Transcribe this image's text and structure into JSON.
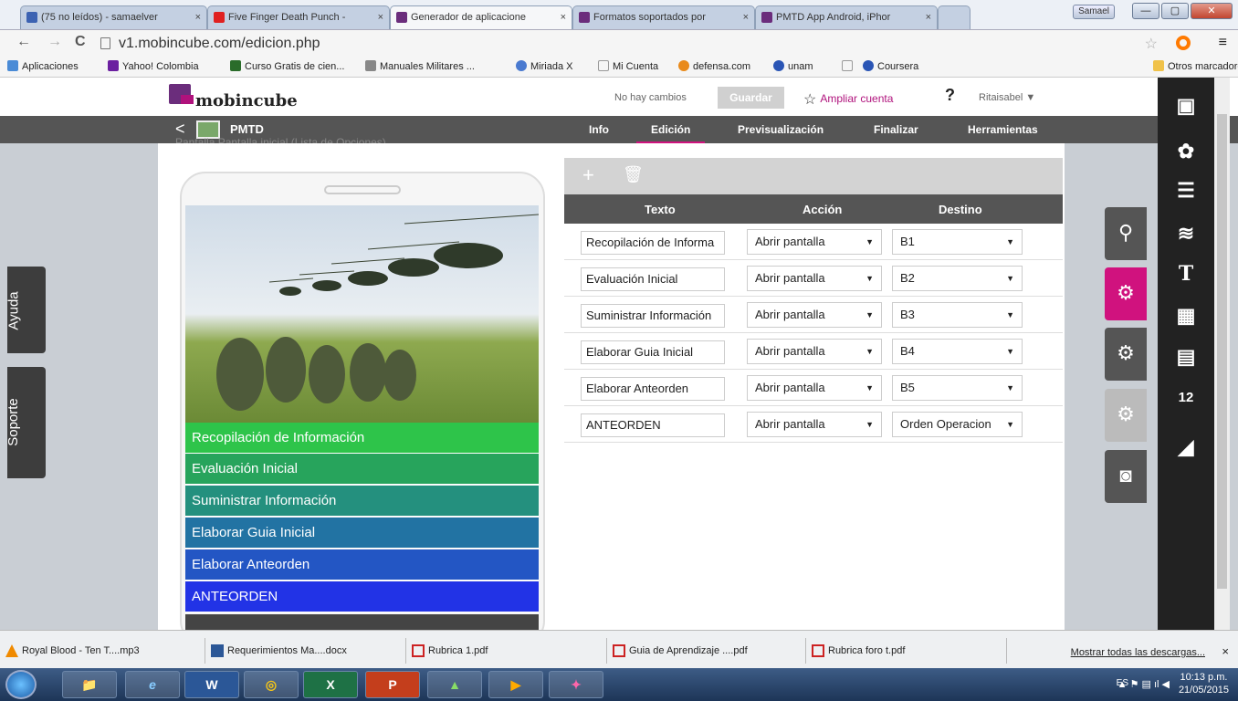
{
  "browser": {
    "tabs": [
      {
        "title": "(75 no leídos) - samaelver",
        "color": "#3c62b2"
      },
      {
        "title": "Five Finger Death Punch -",
        "color": "#e02020"
      },
      {
        "title": "Generador de aplicacione",
        "color": "#6b2d7c"
      },
      {
        "title": "Formatos soportados por",
        "color": "#6b2d7c"
      },
      {
        "title": "PMTD App Android, iPhor",
        "color": "#6b2d7c"
      }
    ],
    "tab_close": "×",
    "user_badge": "Samael",
    "win": {
      "min": "—",
      "max": "▢",
      "close": "✕"
    },
    "nav": {
      "back": "←",
      "forward": "→",
      "reload": "C"
    },
    "url": "v1.mobincube.com/edicion.php",
    "star": "☆",
    "menu": "≡",
    "bookmarks": [
      "Aplicaciones",
      "Yahoo! Colombia",
      "Curso Gratis de cien...",
      "Manuales Militares ...",
      "Miriada X",
      "Mi Cuenta",
      "defensa.com",
      "unam",
      "",
      "Coursera"
    ],
    "other_bookmarks": "Otros marcadores"
  },
  "app": {
    "logo": "mobincube",
    "status": "No hay cambios",
    "save": "Guardar",
    "upgrade": "Ampliar cuenta",
    "upgrade_icon": "☆",
    "help": "?",
    "user": "Ritaisabel ▼",
    "back": "<",
    "project": "PMTD",
    "nav": [
      "Info",
      "Edición",
      "Previsualización",
      "Finalizar",
      "Herramientas"
    ],
    "breadcrumb": "Pantalla  Pantalla inicial  (Lista de Opciones)",
    "help_tab": "Ayuda",
    "support_tab": "Soporte"
  },
  "phone": {
    "items": [
      {
        "label": "Recopilación de Información",
        "color": "#2ec44a"
      },
      {
        "label": "Evaluación Inicial",
        "color": "#27a45c"
      },
      {
        "label": "Suministrar Información",
        "color": "#24907e"
      },
      {
        "label": "Elaborar Guia Inicial",
        "color": "#2273a3"
      },
      {
        "label": "Elaborar Anteorden",
        "color": "#2356c4"
      },
      {
        "label": "ANTEORDEN",
        "color": "#2233e6"
      }
    ]
  },
  "editor": {
    "add": "+",
    "delete": "🗑",
    "headers": [
      "Texto",
      "Acción",
      "Destino"
    ],
    "rows": [
      {
        "texto": "Recopilación de Informa",
        "accion": "Abrir pantalla",
        "destino": "B1"
      },
      {
        "texto": "Evaluación Inicial",
        "accion": "Abrir pantalla",
        "destino": "B2"
      },
      {
        "texto": "Suministrar Información",
        "accion": "Abrir pantalla",
        "destino": "B3"
      },
      {
        "texto": "Elaborar Guia Inicial",
        "accion": "Abrir pantalla",
        "destino": "B4"
      },
      {
        "texto": "Elaborar Anteorden",
        "accion": "Abrir pantalla",
        "destino": "B5"
      },
      {
        "texto": "ANTEORDEN",
        "accion": "Abrir pantalla",
        "destino": "Orden Operacion"
      }
    ],
    "arrow": "▼"
  },
  "side_icons": {
    "panel": [
      "tree-icon",
      "gears-icon",
      "document-gear-icon",
      "document-gear-disabled-icon",
      "phone-preview-icon"
    ],
    "panel_glyphs": [
      "⚲",
      "⚙",
      "⚙",
      "⚙",
      "◙"
    ],
    "bar": [
      "image-icon",
      "palette-icon",
      "stack-icon",
      "database-icon",
      "text-icon",
      "qr-icon",
      "list-icon",
      "calendar-icon",
      "rss-icon"
    ],
    "bar_glyphs": [
      "▣",
      "✿",
      "☰",
      "≋",
      "T",
      "▦",
      "▤",
      "12",
      "◢"
    ]
  },
  "downloads": {
    "items": [
      "Royal Blood - Ten T....mp3",
      "Requerimientos Ma....docx",
      "Rubrica 1.pdf",
      "Guia de Aprendizaje ....pdf",
      "Rubrica foro t.pdf"
    ],
    "show_all": "Mostrar todas las descargas...",
    "close": "×"
  },
  "taskbar": {
    "apps": [
      "📁",
      "e",
      "W",
      "◎",
      "X",
      "P",
      "▲",
      "▶",
      "✦"
    ],
    "lang": "ES",
    "time": "10:13 p.m.",
    "date": "21/05/2015"
  }
}
